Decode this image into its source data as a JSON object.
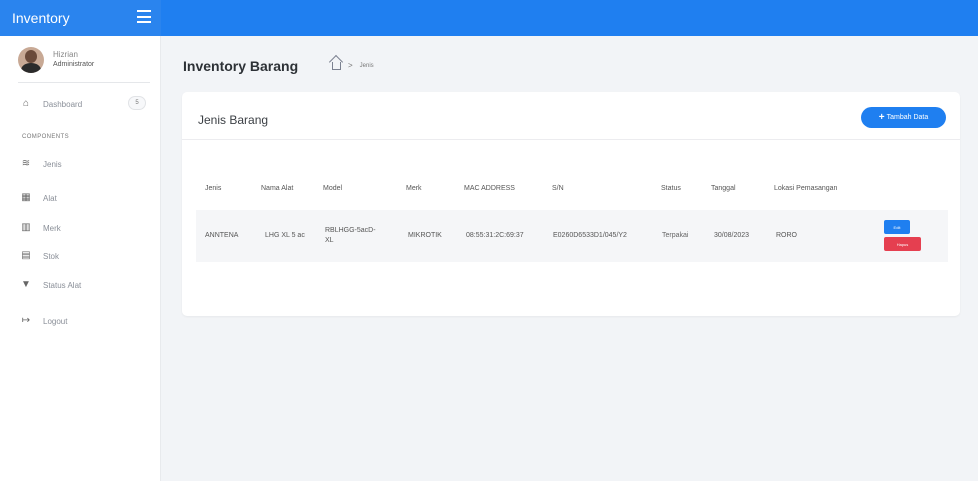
{
  "app": {
    "title": "Inventory"
  },
  "user": {
    "name": "Hizrian",
    "role": "Administrator"
  },
  "sidebar": {
    "dashboard": {
      "label": "Dashboard",
      "badge": "5",
      "icon": "home-icon"
    },
    "section_label": "COMPONENTS",
    "items": [
      {
        "label": "Jenis",
        "icon": "layers-icon"
      },
      {
        "label": "Alat",
        "icon": "grid-icon"
      },
      {
        "label": "Merk",
        "icon": "map-icon"
      },
      {
        "label": "Stok",
        "icon": "boxes-icon"
      },
      {
        "label": "Status Alat",
        "icon": "filter-icon"
      },
      {
        "label": "Logout",
        "icon": "logout-icon"
      }
    ]
  },
  "header": {
    "title": "Inventory Barang",
    "breadcrumb": {
      "home_icon": "home-icon",
      "current": "Jenis"
    }
  },
  "card": {
    "title": "Jenis Barang",
    "add_button": "Tambah Data",
    "columns": [
      "Jenis",
      "Nama Alat",
      "Model",
      "Merk",
      "MAC ADDRESS",
      "S/N",
      "Status",
      "Tanggal",
      "Lokasi Pemasangan"
    ],
    "rows": [
      {
        "jenis": "ANNTENA",
        "nama_alat": "LHG XL 5 ac",
        "model": "RBLHGG-5acD-XL",
        "merk": "MIKROTIK",
        "mac": "08:55:31:2C:69:37",
        "sn": "E0260D6533D1/045/Y2",
        "status": "Terpakai",
        "tanggal": "30/08/2023",
        "lokasi": "RORO",
        "actions": {
          "edit": "Edit",
          "delete": "Hapus"
        }
      }
    ]
  },
  "colors": {
    "primary": "#1f7ff0",
    "danger": "#e53f50",
    "background": "#f2f4f7"
  }
}
